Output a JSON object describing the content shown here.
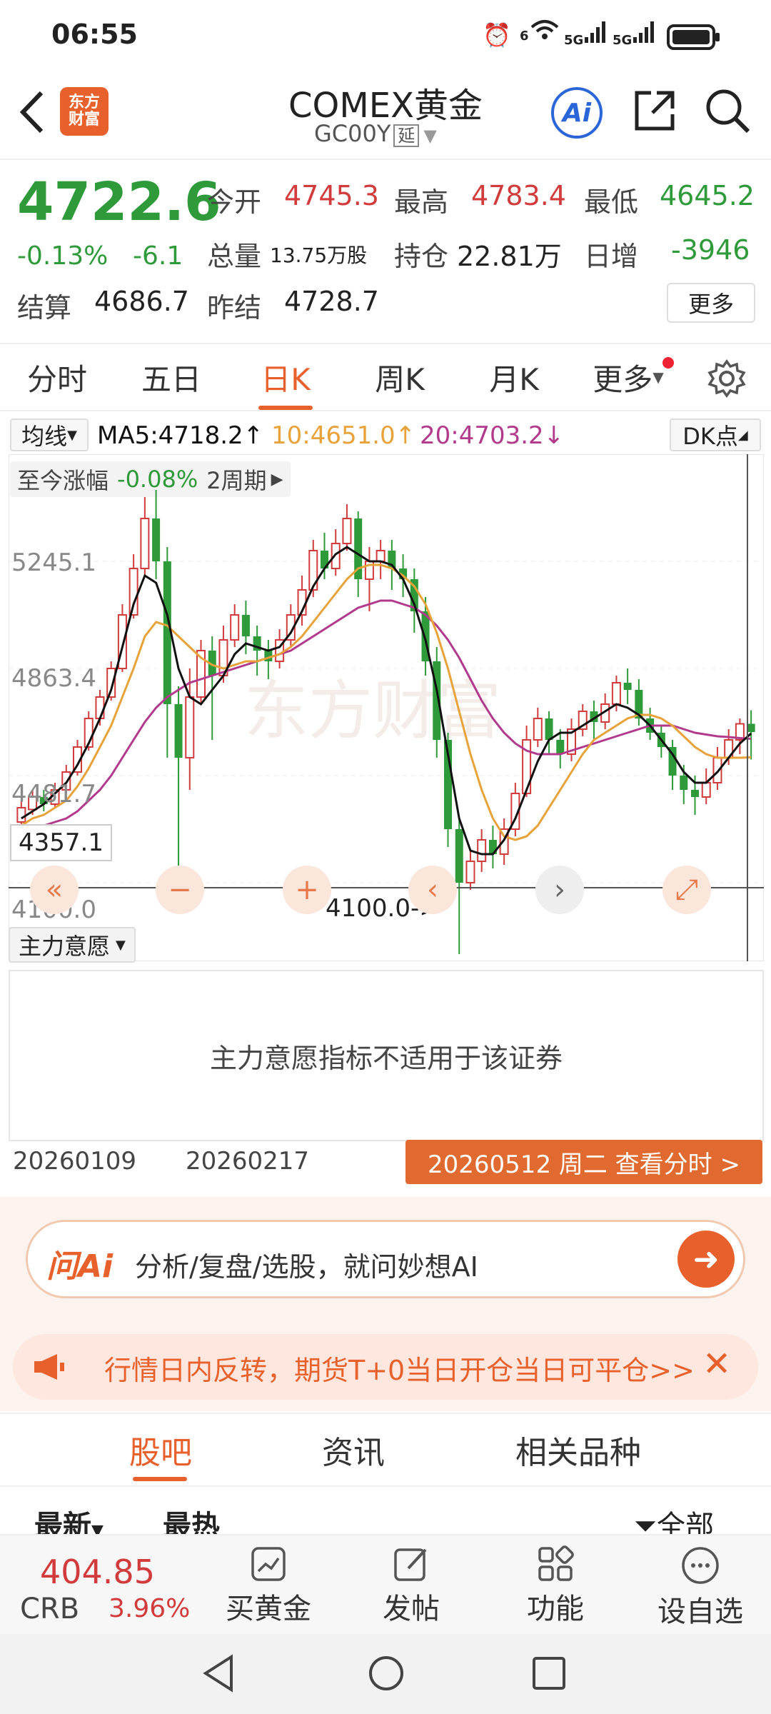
{
  "status": {
    "time": "06:55",
    "net1": "6",
    "net2": "5G",
    "net3": "5G"
  },
  "header": {
    "logo_text": "东方财富",
    "title": "COMEX黄金",
    "code": "GC00Y",
    "delay_tag": "延",
    "ai_label": "Ai"
  },
  "quote": {
    "price": "4722.6",
    "change_pct": "-0.13%",
    "change": "-6.1",
    "open_label": "今开",
    "open": "4745.3",
    "high_label": "最高",
    "high": "4783.4",
    "low_label": "最低",
    "low": "4645.2",
    "volume_label": "总量",
    "volume": "13.75万股",
    "oi_label": "持仓",
    "oi": "22.81万",
    "daily_inc_label": "日增",
    "daily_inc": "-3946",
    "settle_label": "结算",
    "settle": "4686.7",
    "prev_settle_label": "昨结",
    "prev_settle": "4728.7",
    "more_label": "更多"
  },
  "period_tabs": [
    "分时",
    "五日",
    "日K",
    "周K",
    "月K",
    "更多"
  ],
  "active_tab": "日K",
  "indicator": {
    "ma_label": "均线",
    "ma5": "MA5:4718.2↑",
    "ma10": "10:4651.0↑",
    "ma20": "20:4703.2↓",
    "dk_label": "DK点",
    "range_label": "至今涨幅",
    "range_value": "-0.08%",
    "range_period": "2周期"
  },
  "chart_data": {
    "type": "candlestick",
    "y_ticks": [
      "5245.1",
      "4863.4",
      "4481.7",
      "4100.0"
    ],
    "crosshair_price": "4357.1",
    "low_marker": "4100.0->",
    "x_labels": [
      "20260109",
      "20260217"
    ],
    "selected_date": "20260512 周二 查看分时 >",
    "ylim": [
      4100.0,
      5400.0
    ],
    "candles": [
      [
        4470,
        4510,
        4440,
        4530
      ],
      [
        4505,
        4540,
        4490,
        4560
      ],
      [
        4540,
        4520,
        4500,
        4560
      ],
      [
        4520,
        4560,
        4510,
        4580
      ],
      [
        4560,
        4610,
        4550,
        4630
      ],
      [
        4610,
        4680,
        4600,
        4700
      ],
      [
        4680,
        4760,
        4670,
        4780
      ],
      [
        4760,
        4820,
        4740,
        4840
      ],
      [
        4820,
        4900,
        4810,
        4920
      ],
      [
        4900,
        5050,
        4890,
        5080
      ],
      [
        5050,
        5180,
        5040,
        5220
      ],
      [
        5180,
        5320,
        5160,
        5380
      ],
      [
        5320,
        5200,
        5150,
        5400
      ],
      [
        5200,
        4800,
        4650,
        5240
      ],
      [
        4800,
        4650,
        4320,
        4850
      ],
      [
        4650,
        4820,
        4560,
        4900
      ],
      [
        4820,
        4950,
        4800,
        4980
      ],
      [
        4950,
        4880,
        4700,
        4990
      ],
      [
        4880,
        4980,
        4860,
        5020
      ],
      [
        4980,
        5050,
        4960,
        5080
      ],
      [
        5050,
        4990,
        4940,
        5090
      ],
      [
        4990,
        4950,
        4880,
        5020
      ],
      [
        4950,
        4920,
        4870,
        4980
      ],
      [
        4920,
        4980,
        4900,
        5010
      ],
      [
        4980,
        5050,
        4960,
        5080
      ],
      [
        5050,
        5120,
        5020,
        5160
      ],
      [
        5120,
        5230,
        5100,
        5260
      ],
      [
        5230,
        5180,
        5150,
        5280
      ],
      [
        5180,
        5250,
        5160,
        5290
      ],
      [
        5250,
        5320,
        5230,
        5360
      ],
      [
        5320,
        5150,
        5100,
        5340
      ],
      [
        5150,
        5200,
        5060,
        5240
      ],
      [
        5200,
        5230,
        5150,
        5260
      ],
      [
        5230,
        5180,
        5120,
        5260
      ],
      [
        5180,
        5150,
        5100,
        5220
      ],
      [
        5150,
        5060,
        5000,
        5180
      ],
      [
        5060,
        4920,
        4880,
        5100
      ],
      [
        4920,
        4700,
        4650,
        4960
      ],
      [
        4700,
        4450,
        4400,
        4720
      ],
      [
        4450,
        4300,
        4100,
        4480
      ],
      [
        4300,
        4360,
        4280,
        4390
      ],
      [
        4360,
        4420,
        4330,
        4450
      ],
      [
        4420,
        4380,
        4340,
        4460
      ],
      [
        4380,
        4450,
        4350,
        4480
      ],
      [
        4450,
        4550,
        4430,
        4580
      ],
      [
        4550,
        4700,
        4540,
        4740
      ],
      [
        4700,
        4760,
        4680,
        4790
      ],
      [
        4760,
        4700,
        4660,
        4780
      ],
      [
        4700,
        4660,
        4620,
        4730
      ],
      [
        4660,
        4730,
        4640,
        4760
      ],
      [
        4730,
        4780,
        4710,
        4800
      ],
      [
        4780,
        4750,
        4700,
        4810
      ],
      [
        4750,
        4800,
        4730,
        4830
      ],
      [
        4800,
        4860,
        4780,
        4880
      ],
      [
        4860,
        4840,
        4800,
        4900
      ],
      [
        4840,
        4760,
        4740,
        4870
      ],
      [
        4760,
        4720,
        4700,
        4790
      ],
      [
        4720,
        4680,
        4650,
        4740
      ],
      [
        4680,
        4600,
        4560,
        4700
      ],
      [
        4600,
        4560,
        4520,
        4630
      ],
      [
        4560,
        4540,
        4490,
        4600
      ],
      [
        4540,
        4580,
        4520,
        4620
      ],
      [
        4580,
        4650,
        4560,
        4680
      ],
      [
        4650,
        4700,
        4630,
        4730
      ],
      [
        4700,
        4745,
        4660,
        4760
      ],
      [
        4745,
        4722,
        4645,
        4783
      ]
    ],
    "ma5": [
      4480,
      4500,
      4520,
      4550,
      4580,
      4630,
      4690,
      4760,
      4840,
      4960,
      5080,
      5160,
      5140,
      5050,
      4900,
      4820,
      4800,
      4840,
      4880,
      4940,
      4970,
      4960,
      4950,
      4960,
      5000,
      5060,
      5130,
      5180,
      5220,
      5240,
      5220,
      5200,
      5200,
      5190,
      5150,
      5080,
      4980,
      4840,
      4660,
      4480,
      4390,
      4380,
      4380,
      4420,
      4480,
      4560,
      4640,
      4700,
      4720,
      4720,
      4740,
      4760,
      4780,
      4800,
      4790,
      4770,
      4740,
      4700,
      4660,
      4610,
      4580,
      4580,
      4610,
      4650,
      4690,
      4718
    ],
    "ma10": [
      4460,
      4480,
      4490,
      4510,
      4530,
      4570,
      4620,
      4680,
      4740,
      4820,
      4900,
      4990,
      5030,
      5020,
      4990,
      4960,
      4930,
      4910,
      4900,
      4910,
      4920,
      4920,
      4930,
      4940,
      4960,
      4990,
      5030,
      5070,
      5110,
      5150,
      5180,
      5190,
      5190,
      5180,
      5160,
      5130,
      5080,
      5000,
      4900,
      4780,
      4660,
      4560,
      4480,
      4430,
      4420,
      4430,
      4460,
      4510,
      4560,
      4610,
      4660,
      4700,
      4720,
      4740,
      4760,
      4770,
      4770,
      4760,
      4740,
      4710,
      4680,
      4660,
      4650,
      4650,
      4650,
      4651
    ],
    "ma20": [
      4440,
      4450,
      4460,
      4470,
      4480,
      4500,
      4530,
      4560,
      4600,
      4650,
      4700,
      4750,
      4790,
      4820,
      4840,
      4860,
      4870,
      4880,
      4890,
      4900,
      4910,
      4920,
      4930,
      4940,
      4950,
      4970,
      4990,
      5010,
      5030,
      5050,
      5070,
      5080,
      5090,
      5090,
      5080,
      5070,
      5050,
      5020,
      4980,
      4930,
      4870,
      4810,
      4760,
      4720,
      4690,
      4670,
      4660,
      4660,
      4660,
      4670,
      4680,
      4690,
      4700,
      4710,
      4720,
      4730,
      4740,
      4740,
      4740,
      4730,
      4720,
      4715,
      4710,
      4708,
      4705,
      4703
    ]
  },
  "sub_indicator": {
    "label": "主力意愿",
    "message": "主力意愿指标不适用于该证券"
  },
  "ai_bar": {
    "brand": "问Ai",
    "prompt": "分析/复盘/选股，就问妙想AI"
  },
  "banner": {
    "text": "行情日内反转，期货T+0当日开仓当日可平仓>>"
  },
  "sub_tabs": [
    "股吧",
    "资讯",
    "相关品种"
  ],
  "filters": {
    "latest": "最新",
    "hot": "最热",
    "all": "全部"
  },
  "bottom": {
    "crb_value": "404.85",
    "crb_label": "CRB",
    "crb_change": "3.96%",
    "buy": "买黄金",
    "post": "发帖",
    "func": "功能",
    "watch": "设自选"
  },
  "colors": {
    "up": "#d23b3b",
    "down": "#2f9a3a",
    "accent": "#e8612c",
    "ma5": "#111111",
    "ma10": "#e8a23a",
    "ma20": "#b23a8c"
  }
}
